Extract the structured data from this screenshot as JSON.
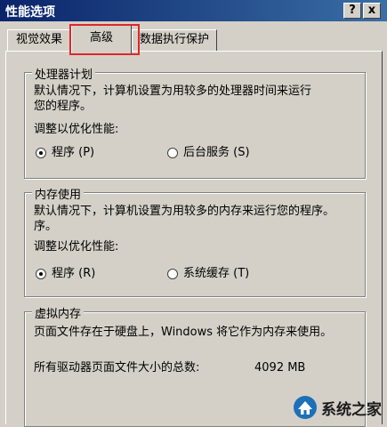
{
  "window": {
    "title": "性能选项",
    "help_button": "?",
    "close_button": "x"
  },
  "tabs": [
    {
      "label": "视觉效果"
    },
    {
      "label": "高级"
    },
    {
      "label": "数据执行保护"
    }
  ],
  "processor": {
    "legend": "处理器计划",
    "description_line1": "默认情况下，计算机设置为用较多的处理器时间来运行",
    "description_line2": "您的程序。",
    "adjust_label": "调整以优化性能:",
    "option_programs": "程序 (P)",
    "option_background": "后台服务 (S)"
  },
  "memory": {
    "legend": "内存使用",
    "description_line1": "默认情况下，计算机设置为用较多的内存来运行您的程序。",
    "description_line2": "序。",
    "adjust_label": "调整以优化性能:",
    "option_programs": "程序 (R)",
    "option_system_cache": "系统缓存 (T)"
  },
  "virtual_memory": {
    "legend": "虚拟内存",
    "description": "页面文件存在于硬盘上，Windows 将它作为内存来使用。",
    "total_label": "所有驱动器页面文件大小的总数:",
    "total_value": "4092 MB"
  },
  "watermark": {
    "text": "系统之家"
  },
  "colors": {
    "titlebar_start": "#0a246a",
    "titlebar_end": "#3a6ea5",
    "highlight": "#e0262a",
    "dialog_bg": "#d4d0c8"
  }
}
